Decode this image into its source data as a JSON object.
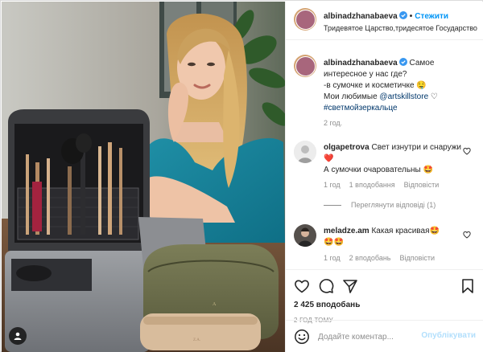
{
  "post": {
    "author": "albinadzhanabaeva",
    "follow_label": "Стежити",
    "separator": "•",
    "location": "Тридевятое Царство,тридесятое Государство",
    "caption": {
      "username": "albinadzhanabaeva",
      "lines": [
        "Самое интересное у нас где?",
        "-в сумочке и косметичке 🤤",
        "Мои любимые "
      ],
      "mention": "@artskillstore",
      "heart": "♡",
      "hashtag": "#светмойзеркальце",
      "time": "2 год."
    },
    "likes": "2 425 вподобань",
    "posted_ago": "2 ГОД ТОМУ"
  },
  "comments": [
    {
      "username": "olgapetrova",
      "text_1": "Свет изнутри и снаружи ❤️",
      "text_2": "А сумочки очаровательны 🤩",
      "time": "1 год",
      "likes": "1 вподобання",
      "reply": "Відповісти",
      "view_replies": "Переглянути відповіді (1)"
    },
    {
      "username": "meladze.am",
      "text_1": "Какая красивая🤩",
      "text_2": "🤩🤩",
      "time": "1 год",
      "likes": "2 вподобань",
      "reply": "Відповісти"
    }
  ],
  "comment_box": {
    "placeholder": "Додайте коментар...",
    "post_label": "Опублікувати"
  },
  "icons": {
    "verified": "verified-badge-icon",
    "like": "heart-icon",
    "comment": "comment-icon",
    "share": "share-icon",
    "save": "bookmark-icon",
    "emoji": "emoji-icon",
    "tag": "user-tag-icon"
  },
  "colors": {
    "accent": "#0095f6",
    "verified": "#3897f0",
    "muted": "#8e8e8e",
    "link": "#00376b",
    "heart": "#ed4956"
  }
}
